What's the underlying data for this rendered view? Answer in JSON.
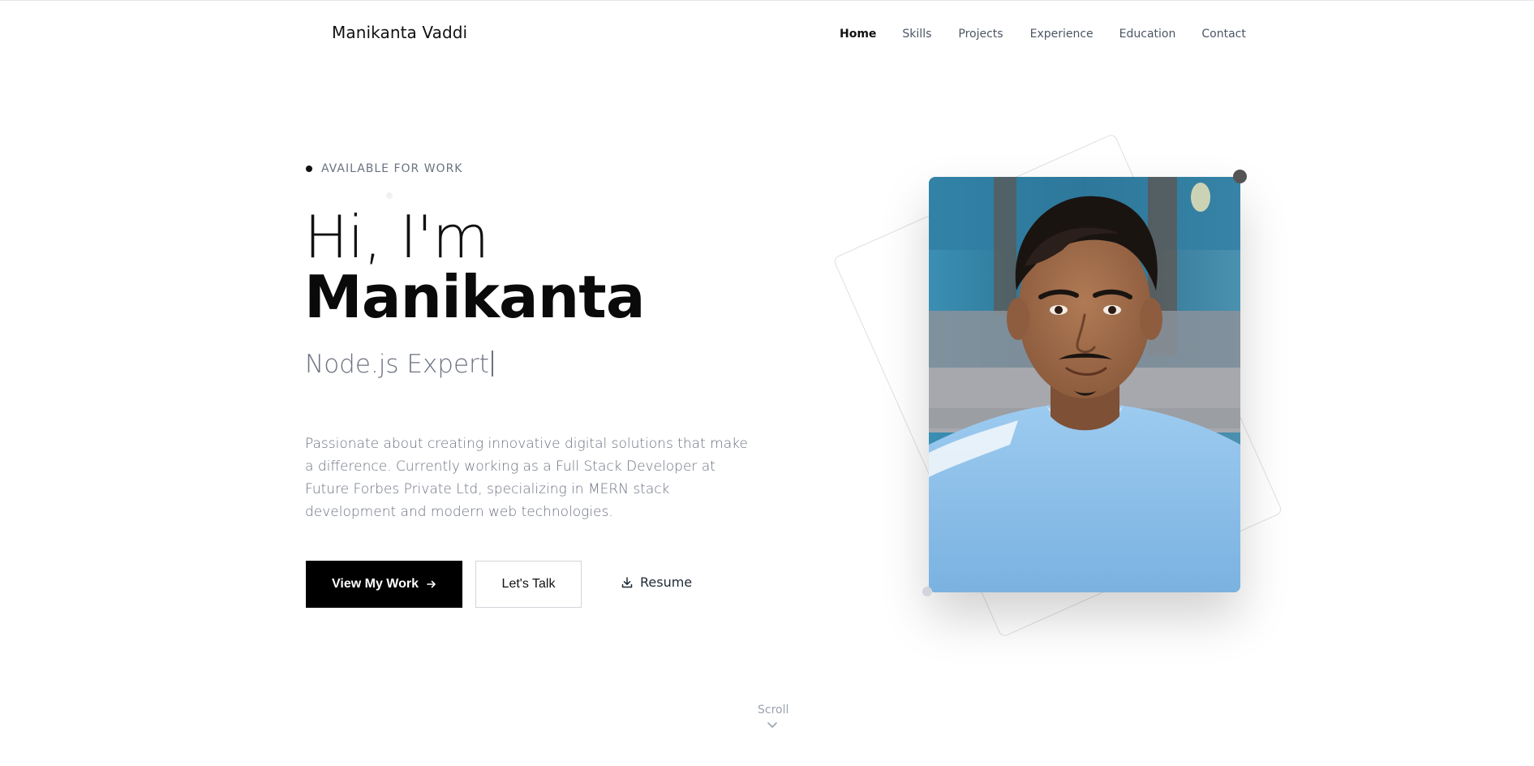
{
  "header": {
    "brand": "Manikanta Vaddi",
    "nav": [
      {
        "label": "Home",
        "active": true
      },
      {
        "label": "Skills"
      },
      {
        "label": "Projects"
      },
      {
        "label": "Experience"
      },
      {
        "label": "Education"
      },
      {
        "label": "Contact"
      }
    ]
  },
  "hero": {
    "availability": "AVAILABLE FOR WORK",
    "greeting": "Hi, I'm",
    "name": "Manikanta",
    "role": "Node.js Expert",
    "description": "Passionate about creating innovative digital solutions that make a difference. Currently working as a Full Stack Developer at Future Forbes Private Ltd, specializing in MERN stack development and modern web technologies.",
    "primary_cta": "View My Work",
    "secondary_cta": "Let's Talk",
    "resume_cta": "Resume",
    "icons": {
      "arrow": "arrow-right-icon",
      "download": "download-icon"
    }
  },
  "scroll_hint": "Scroll",
  "colors": {
    "primary_button": "#000000",
    "text_muted": "#6b7280",
    "shirt": "#8ec1ea",
    "background_wall": "#2e6f8f"
  }
}
